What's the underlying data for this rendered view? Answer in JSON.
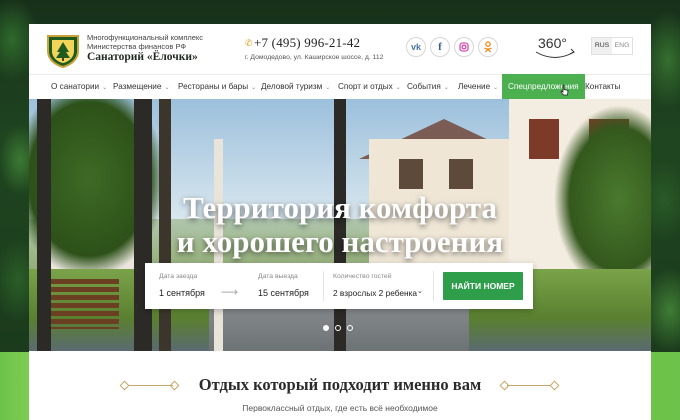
{
  "header": {
    "brand_line1": "Многофункциональный комплекс",
    "brand_line2": "Министерства финансов РФ",
    "brand_name": "Санаторий «Ёлочки»",
    "phone": "+7 (495) 996-21-42",
    "address": "г. Домодедово, ул. Каширское шоссе, д. 112",
    "social": [
      "vk-icon",
      "facebook-icon",
      "instagram-icon",
      "odnoklassniki-icon"
    ],
    "tour_label": "360°",
    "languages": [
      "RUS",
      "ENG"
    ],
    "active_language": "RUS"
  },
  "nav": {
    "items": [
      {
        "label": "О санатории",
        "dropdown": true
      },
      {
        "label": "Размещение",
        "dropdown": true
      },
      {
        "label": "Рестораны и бары",
        "dropdown": true
      },
      {
        "label": "Деловой туризм",
        "dropdown": true
      },
      {
        "label": "Спорт и отдых",
        "dropdown": true
      },
      {
        "label": "События",
        "dropdown": true
      },
      {
        "label": "Лечение",
        "dropdown": true
      },
      {
        "label": "Спецпредложения",
        "dropdown": false,
        "highlighted": true
      },
      {
        "label": "Контакты",
        "dropdown": false
      }
    ]
  },
  "hero": {
    "title_line1": "Территория комфорта",
    "title_line2": "и хорошего настроения",
    "slides_total": 3,
    "active_slide": 1
  },
  "booking": {
    "checkin_label": "Дата заезда",
    "checkin_value": "1 сентября",
    "checkout_label": "Дата выезда",
    "checkout_value": "15 сентября",
    "guests_label": "Количество гостей",
    "guests_value": "2 взрослых 2 ребенка",
    "search_button": "НАЙТИ НОМЕР"
  },
  "section": {
    "title": "Отдых который подходит именно вам",
    "subtitle": "Первоклассный отдых, где есть всё необходимое"
  },
  "colors": {
    "accent_green": "#4caf50",
    "button_green": "#2e9e4a",
    "ornament_gold": "#c9a66b",
    "phone_icon": "#e1a12a"
  }
}
